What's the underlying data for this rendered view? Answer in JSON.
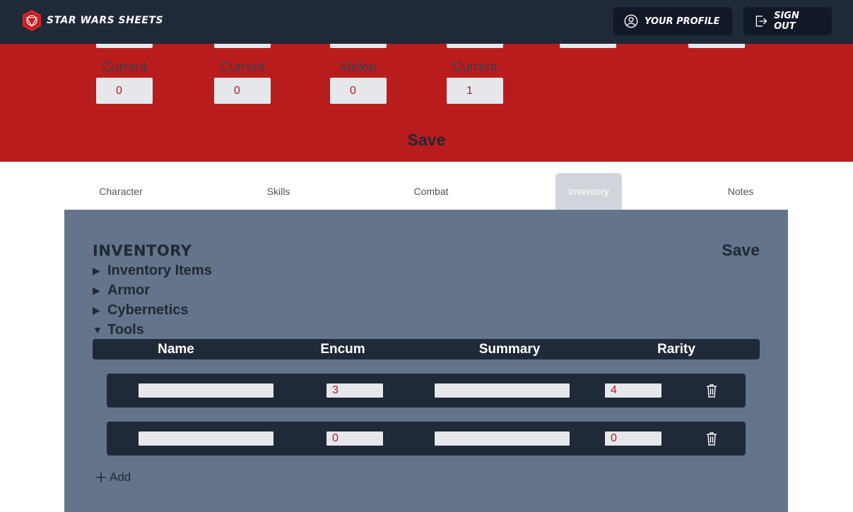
{
  "header": {
    "brand": "Star Wars Sheets",
    "profile_label": "Your Profile",
    "signout_label": "Sign Out"
  },
  "stats": {
    "items": [
      {
        "label": "Current",
        "value": "0"
      },
      {
        "label": "Current",
        "value": "0"
      },
      {
        "label": "Melee",
        "value": "0"
      },
      {
        "label": "Current",
        "value": "1"
      }
    ],
    "save_label": "Save"
  },
  "tabs": [
    {
      "label": "Character"
    },
    {
      "label": "Skills"
    },
    {
      "label": "Combat"
    },
    {
      "label": "Inventory",
      "active": true
    },
    {
      "label": "Notes"
    }
  ],
  "inventory": {
    "title": "Inventory",
    "save_label": "Save",
    "sections": [
      {
        "label": "Inventory Items",
        "expanded": false
      },
      {
        "label": "Armor",
        "expanded": false
      },
      {
        "label": "Cybernetics",
        "expanded": false
      },
      {
        "label": "Tools",
        "expanded": true
      }
    ],
    "columns": [
      "Name",
      "Encum",
      "Summary",
      "Rarity"
    ],
    "rows": [
      {
        "name": "",
        "encum": "3",
        "summary": "",
        "rarity": "4"
      },
      {
        "name": "",
        "encum": "0",
        "summary": "",
        "rarity": "0"
      }
    ],
    "add_label": "Add"
  },
  "colors": {
    "header_bg": "#1f2937",
    "stats_bg": "#b91c1c",
    "panel_bg": "#64748b",
    "input_text": "#b91c1c"
  }
}
